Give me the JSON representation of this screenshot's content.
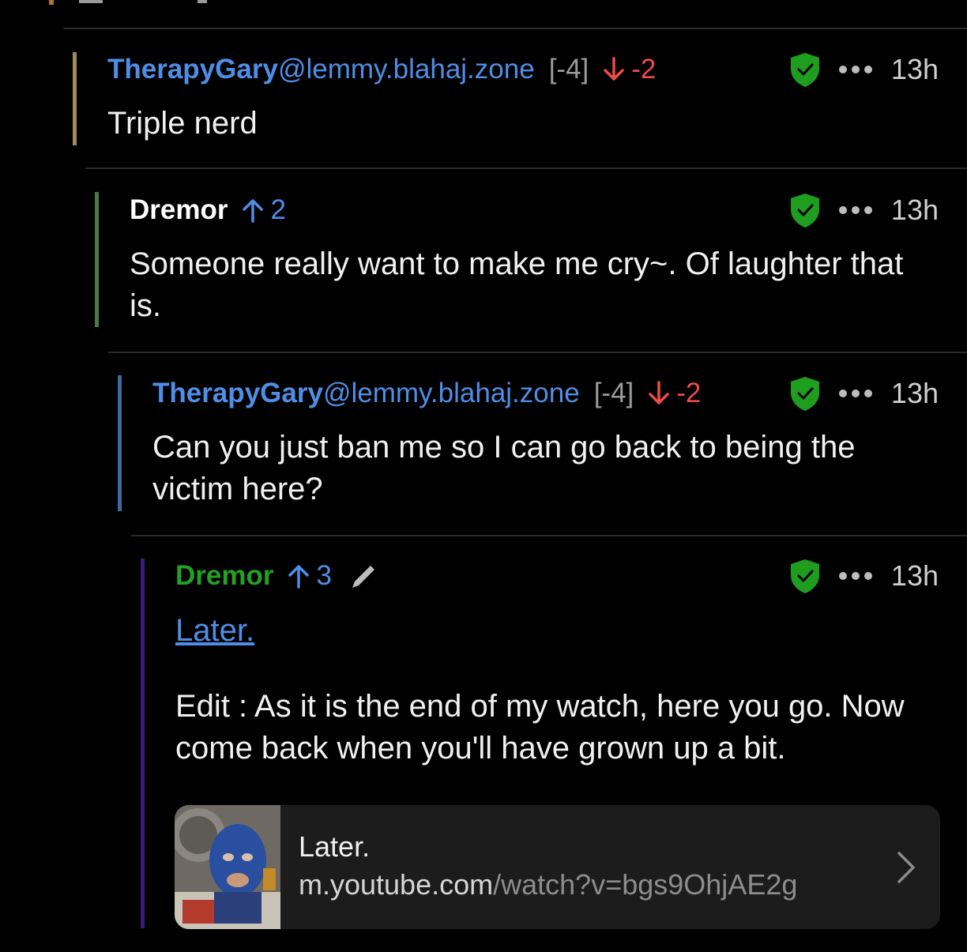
{
  "comments": [
    {
      "author": "TherapyGary",
      "instance": "@lemmy.blahaj.zone",
      "score": "[-4]",
      "vote_count": "-2",
      "time": "13h",
      "body": "Triple nerd"
    },
    {
      "author": "Dremor",
      "vote_count": "2",
      "time": "13h",
      "body": "Someone really want to make me cry~. Of laughter that is."
    },
    {
      "author": "TherapyGary",
      "instance": "@lemmy.blahaj.zone",
      "score": "[-4]",
      "vote_count": "-2",
      "time": "13h",
      "body": "Can you just ban me so I can go back to being the victim here?"
    },
    {
      "author": "Dremor",
      "vote_count": "3",
      "time": "13h",
      "link_text": "Later.",
      "body": "Edit : As it is the end of my watch, here you go. Now come back when you'll have grown up a bit.",
      "card": {
        "title": "Later.",
        "domain": "m.youtube.com",
        "path": "/watch?v=bgs9OhjAE2g"
      }
    }
  ],
  "colors": {
    "background": "#000000",
    "author_link": "#4f8ee6",
    "moderator_name": "#23a123",
    "downvote": "#ef4b4b",
    "upvote": "#4f8ee6",
    "shield": "#1f9d1f",
    "thread_bar_1": "#a08a55",
    "thread_bar_2": "#4a7a4a",
    "thread_bar_3": "#3d6aa3",
    "thread_bar_4": "#3e1a7a"
  },
  "icons": [
    "arrow-up-icon",
    "arrow-down-icon",
    "shield-check-icon",
    "more-dots-icon",
    "pencil-icon",
    "chevron-right-icon"
  ]
}
